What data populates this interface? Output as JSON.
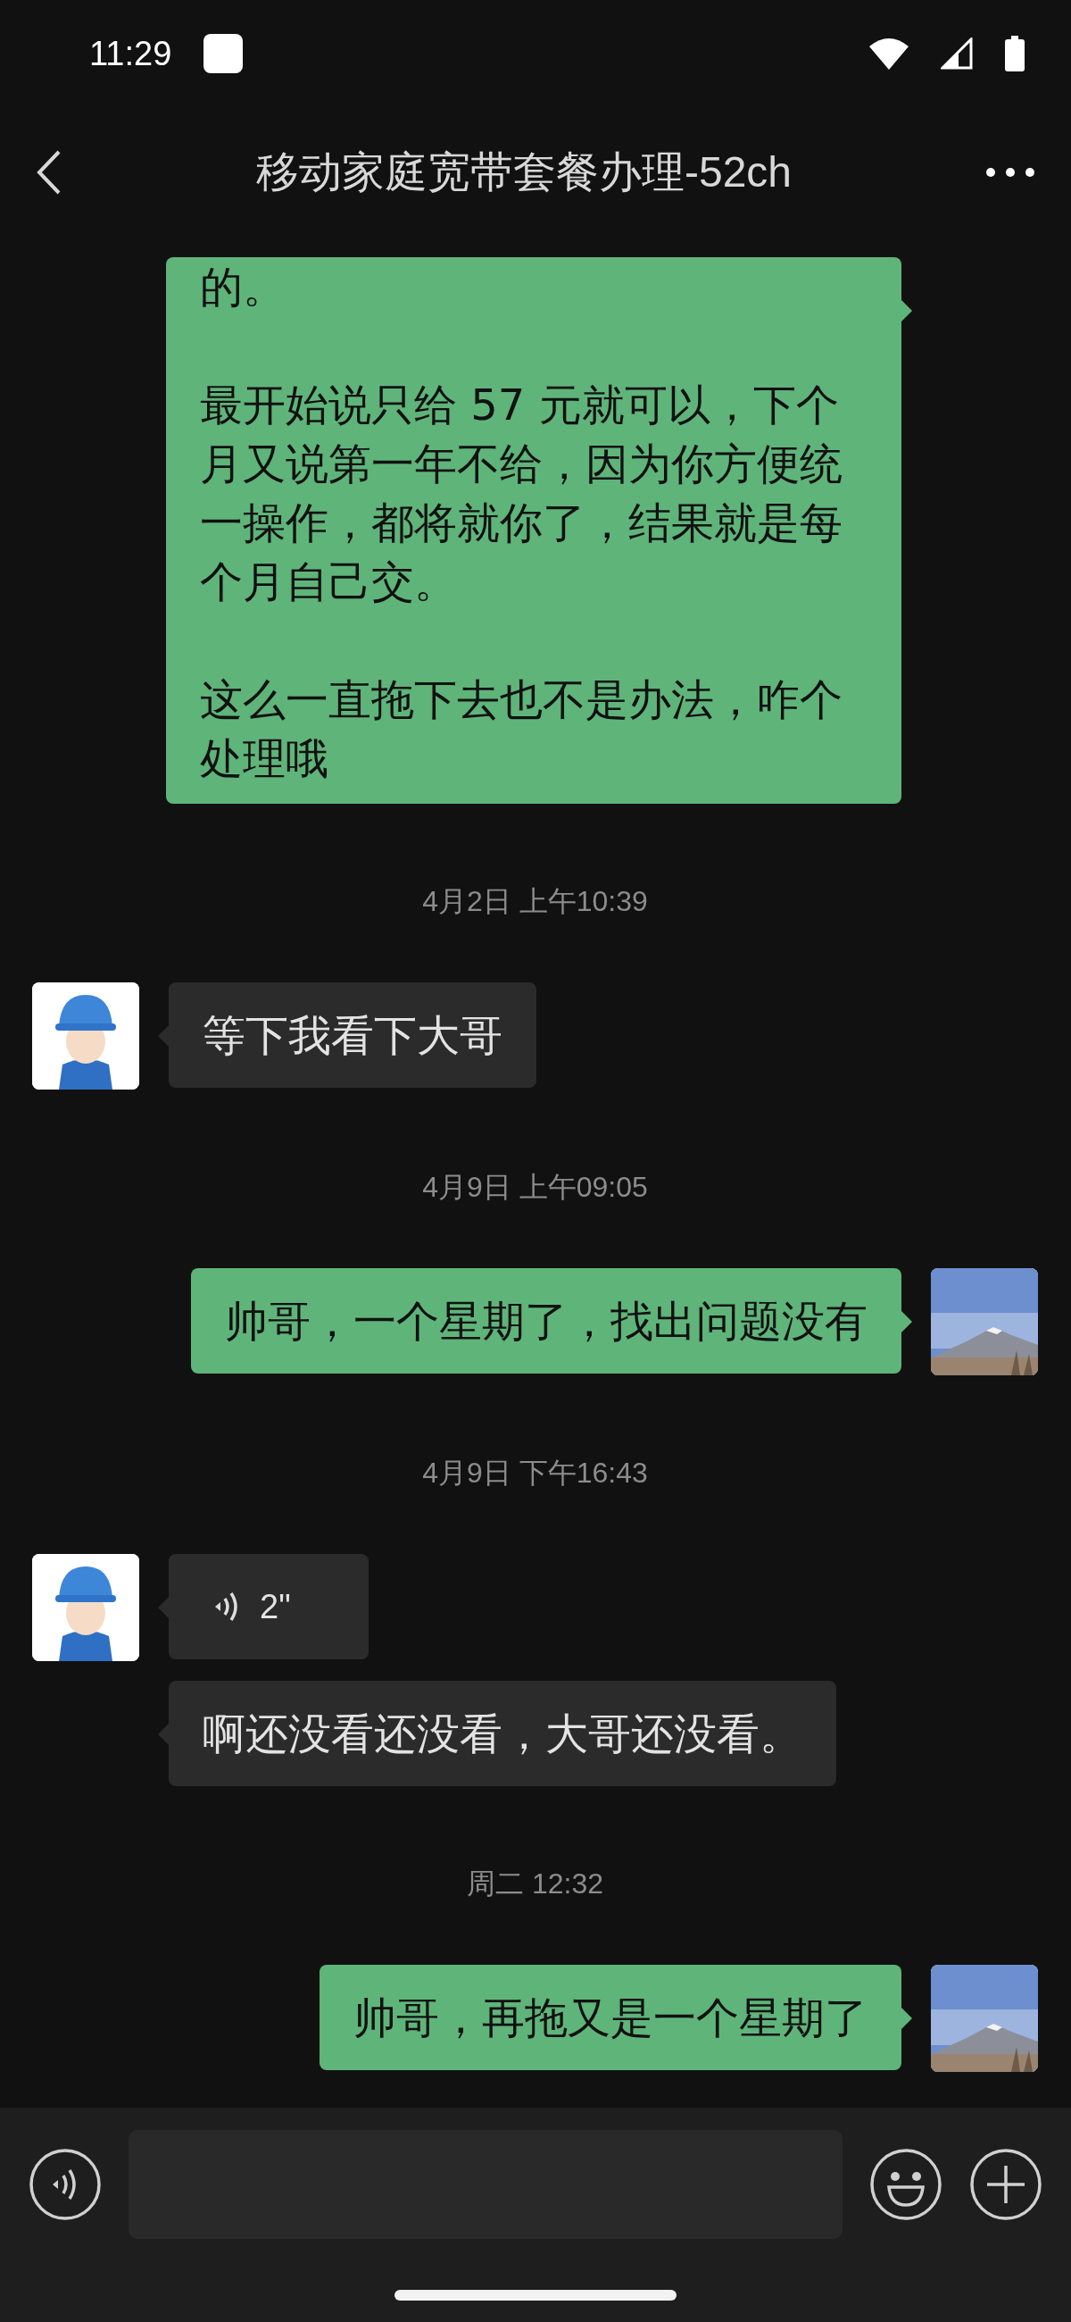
{
  "status_bar": {
    "time": "11:29"
  },
  "header": {
    "title": "移动家庭宽带套餐办理-52ch"
  },
  "messages": [
    {
      "kind": "text",
      "outgoing": true,
      "avatar": false,
      "paragraphs": [
        "的。",
        "最开始说只给 57 元就可以，下个月又说第一年不给，因为你方便统一操作，都将就你了，结果就是每个月自己交。",
        "这么一直拖下去也不是办法，咋个处理哦"
      ]
    },
    {
      "kind": "time",
      "text": "4月2日 上午10:39"
    },
    {
      "kind": "text",
      "outgoing": false,
      "avatar": true,
      "paragraphs": [
        "等下我看下大哥"
      ]
    },
    {
      "kind": "time",
      "text": "4月9日 上午09:05"
    },
    {
      "kind": "text",
      "outgoing": true,
      "avatar": true,
      "paragraphs": [
        "帅哥，一个星期了，找出问题没有"
      ]
    },
    {
      "kind": "time",
      "text": "4月9日 下午16:43"
    },
    {
      "kind": "voice",
      "outgoing": false,
      "avatar": true,
      "duration": "2\""
    },
    {
      "kind": "text",
      "outgoing": false,
      "avatar": false,
      "paragraphs": [
        "啊还没看还没看，大哥还没看。"
      ]
    },
    {
      "kind": "time",
      "text": "周二 12:32"
    },
    {
      "kind": "text",
      "outgoing": true,
      "avatar": true,
      "paragraphs": [
        "帅哥，再拖又是一个星期了"
      ]
    }
  ]
}
